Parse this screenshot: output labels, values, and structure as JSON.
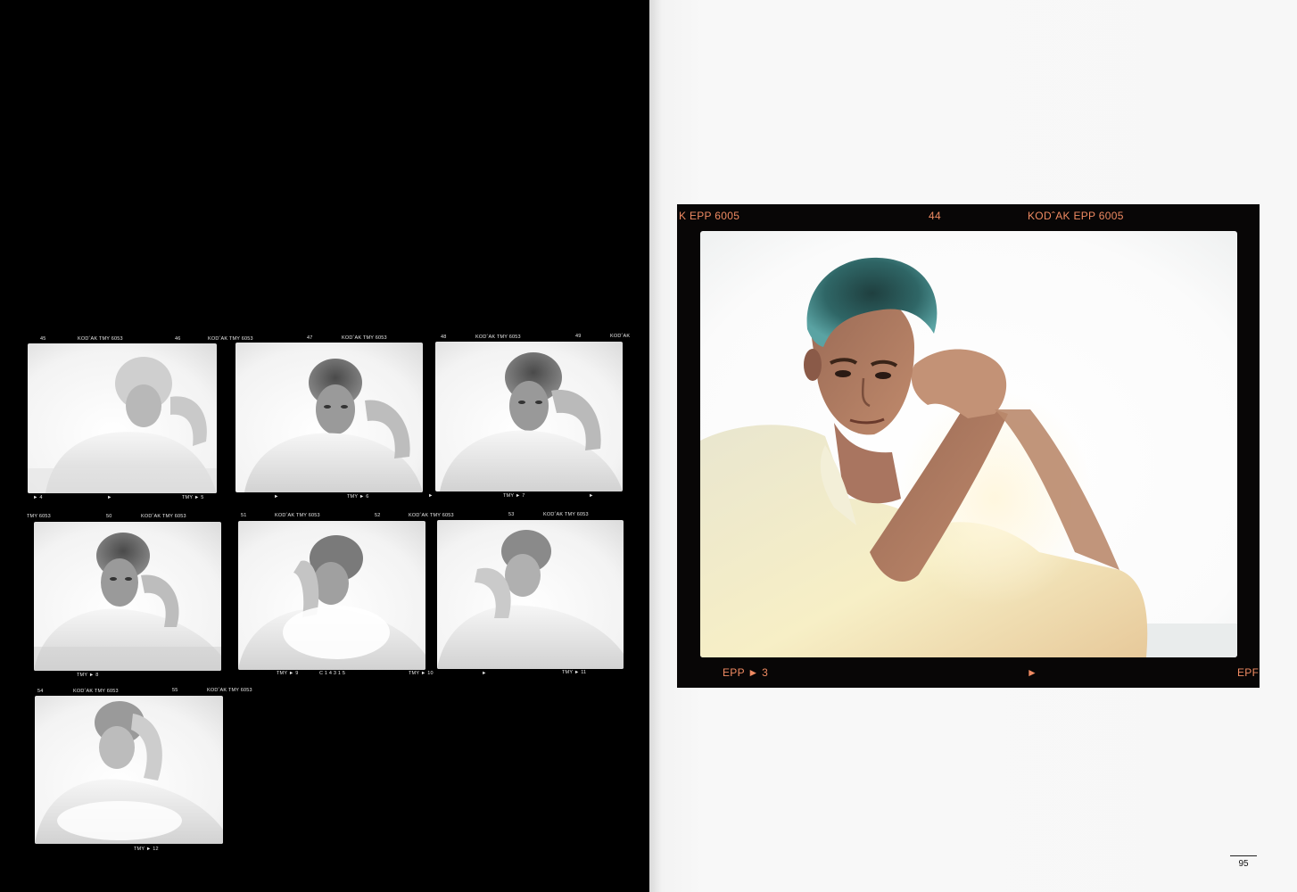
{
  "contact_sheet": {
    "rows": [
      {
        "top_labels": [
          "45",
          "KODˆAK  TMY  6053",
          "46",
          "KODˆAK  TMY  6053",
          "47",
          "KODˆAK  TMY  6053",
          "48",
          "KODˆAK  TMY  6053",
          "49",
          "KODˆAK"
        ],
        "bottom_labels": [
          "► 4",
          "►",
          "TMY ► 5",
          "►",
          "TMY ► 6",
          "►",
          "TMY ► 7",
          "►"
        ]
      },
      {
        "top_labels": [
          "TMY  6053",
          "50",
          "KODˆAK  TMY  6053",
          "51",
          "KODˆAK  TMY  6053",
          "52",
          "KODˆAK  TMY  6053",
          "53",
          "KODˆAK  TMY  6053"
        ],
        "bottom_labels": [
          "TMY ► 8",
          "TMY ► 9",
          "C  1  4  3  1  5",
          "TMY ► 10",
          "►",
          "TMY ► 11"
        ]
      },
      {
        "top_labels": [
          "54",
          "KODˆAK  TMY  6053",
          "55",
          "KODˆAK  TMY  6053"
        ],
        "bottom_labels": [
          "TMY ► 12"
        ]
      }
    ]
  },
  "slide": {
    "top_left": "K  EPP 6005",
    "top_center": "44",
    "top_right": "KODˆAK EPP 6005",
    "bottom_left": "EPP  ►  3",
    "bottom_center": "►",
    "bottom_right": "EPF"
  },
  "page_number": "95",
  "colors": {
    "edge_print": "#ef8a62",
    "film_base": "#080606",
    "right_page": "#f7f7f7"
  }
}
